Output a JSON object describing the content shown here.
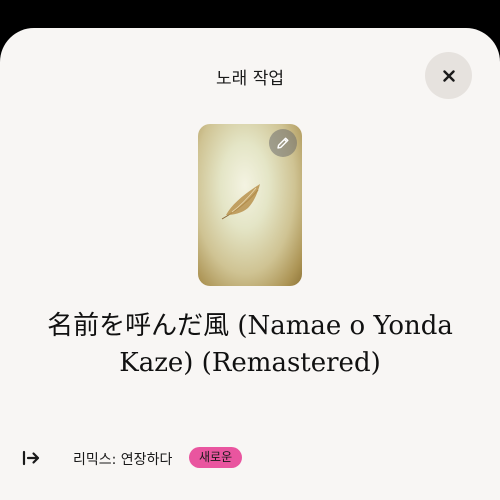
{
  "sheet": {
    "title": "노래 작업",
    "close_icon": "close-icon"
  },
  "artwork": {
    "edit_icon": "pencil-icon",
    "image_icon": "feather-icon"
  },
  "song": {
    "title": "名前を呼んだ風 (Namae o Yonda Kaze) (Remastered)"
  },
  "actions": [
    {
      "icon": "arrow-to-right-icon",
      "label": "리믹스: 연장하다",
      "badge": "새로운",
      "badge_color": "#e9559f"
    }
  ]
}
